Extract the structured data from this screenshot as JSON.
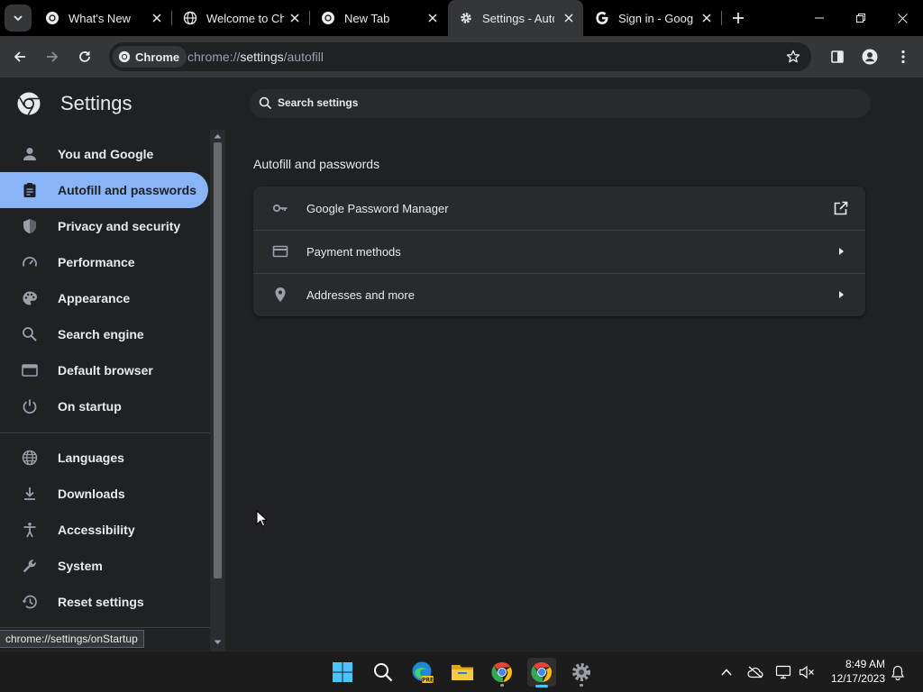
{
  "tabs": [
    {
      "title": "What's New",
      "favicon": "chrome-icon",
      "active": false
    },
    {
      "title": "Welcome to Ch",
      "favicon": "globe-icon",
      "active": false
    },
    {
      "title": "New Tab",
      "favicon": "chrome-icon",
      "active": false
    },
    {
      "title": "Settings - Auto",
      "favicon": "gear-icon",
      "active": true
    },
    {
      "title": "Sign in - Googl",
      "favicon": "google-icon",
      "active": false
    }
  ],
  "toolbar": {
    "chip_label": "Chrome",
    "url_prefix": "chrome://",
    "url_host": "settings",
    "url_path": "/autofill"
  },
  "settings": {
    "title": "Settings",
    "search_placeholder": "Search settings"
  },
  "sidebar": {
    "items": [
      {
        "label": "You and Google",
        "icon": "person-icon",
        "selected": false
      },
      {
        "label": "Autofill and passwords",
        "icon": "clipboard-icon",
        "selected": true
      },
      {
        "label": "Privacy and security",
        "icon": "shield-icon",
        "selected": false
      },
      {
        "label": "Performance",
        "icon": "speedometer-icon",
        "selected": false
      },
      {
        "label": "Appearance",
        "icon": "palette-icon",
        "selected": false
      },
      {
        "label": "Search engine",
        "icon": "search-icon",
        "selected": false
      },
      {
        "label": "Default browser",
        "icon": "browser-icon",
        "selected": false
      },
      {
        "label": "On startup",
        "icon": "power-icon",
        "selected": false
      },
      {
        "label": "Languages",
        "icon": "globe-icon",
        "selected": false
      },
      {
        "label": "Downloads",
        "icon": "download-icon",
        "selected": false
      },
      {
        "label": "Accessibility",
        "icon": "accessibility-icon",
        "selected": false
      },
      {
        "label": "System",
        "icon": "wrench-icon",
        "selected": false
      },
      {
        "label": "Reset settings",
        "icon": "history-icon",
        "selected": false
      }
    ]
  },
  "main": {
    "section_title": "Autofill and passwords",
    "rows": [
      {
        "label": "Google Password Manager",
        "icon": "key-icon",
        "action": "external-link-icon"
      },
      {
        "label": "Payment methods",
        "icon": "credit-card-icon",
        "action": "arrow-right-icon"
      },
      {
        "label": "Addresses and more",
        "icon": "location-pin-icon",
        "action": "arrow-right-icon"
      }
    ]
  },
  "status_url": "chrome://settings/onStartup",
  "taskbar": {
    "apps": [
      "windows-start-icon",
      "search-icon",
      "edge-beta-icon",
      "file-explorer-icon",
      "chrome-icon",
      "chrome-icon",
      "settings-gear-icon"
    ],
    "time": "8:49 AM",
    "date": "12/17/2023"
  },
  "colors": {
    "accent": "#8ab4f8",
    "background": "#202124",
    "toolbar": "#35363a",
    "card": "#292a2d"
  }
}
